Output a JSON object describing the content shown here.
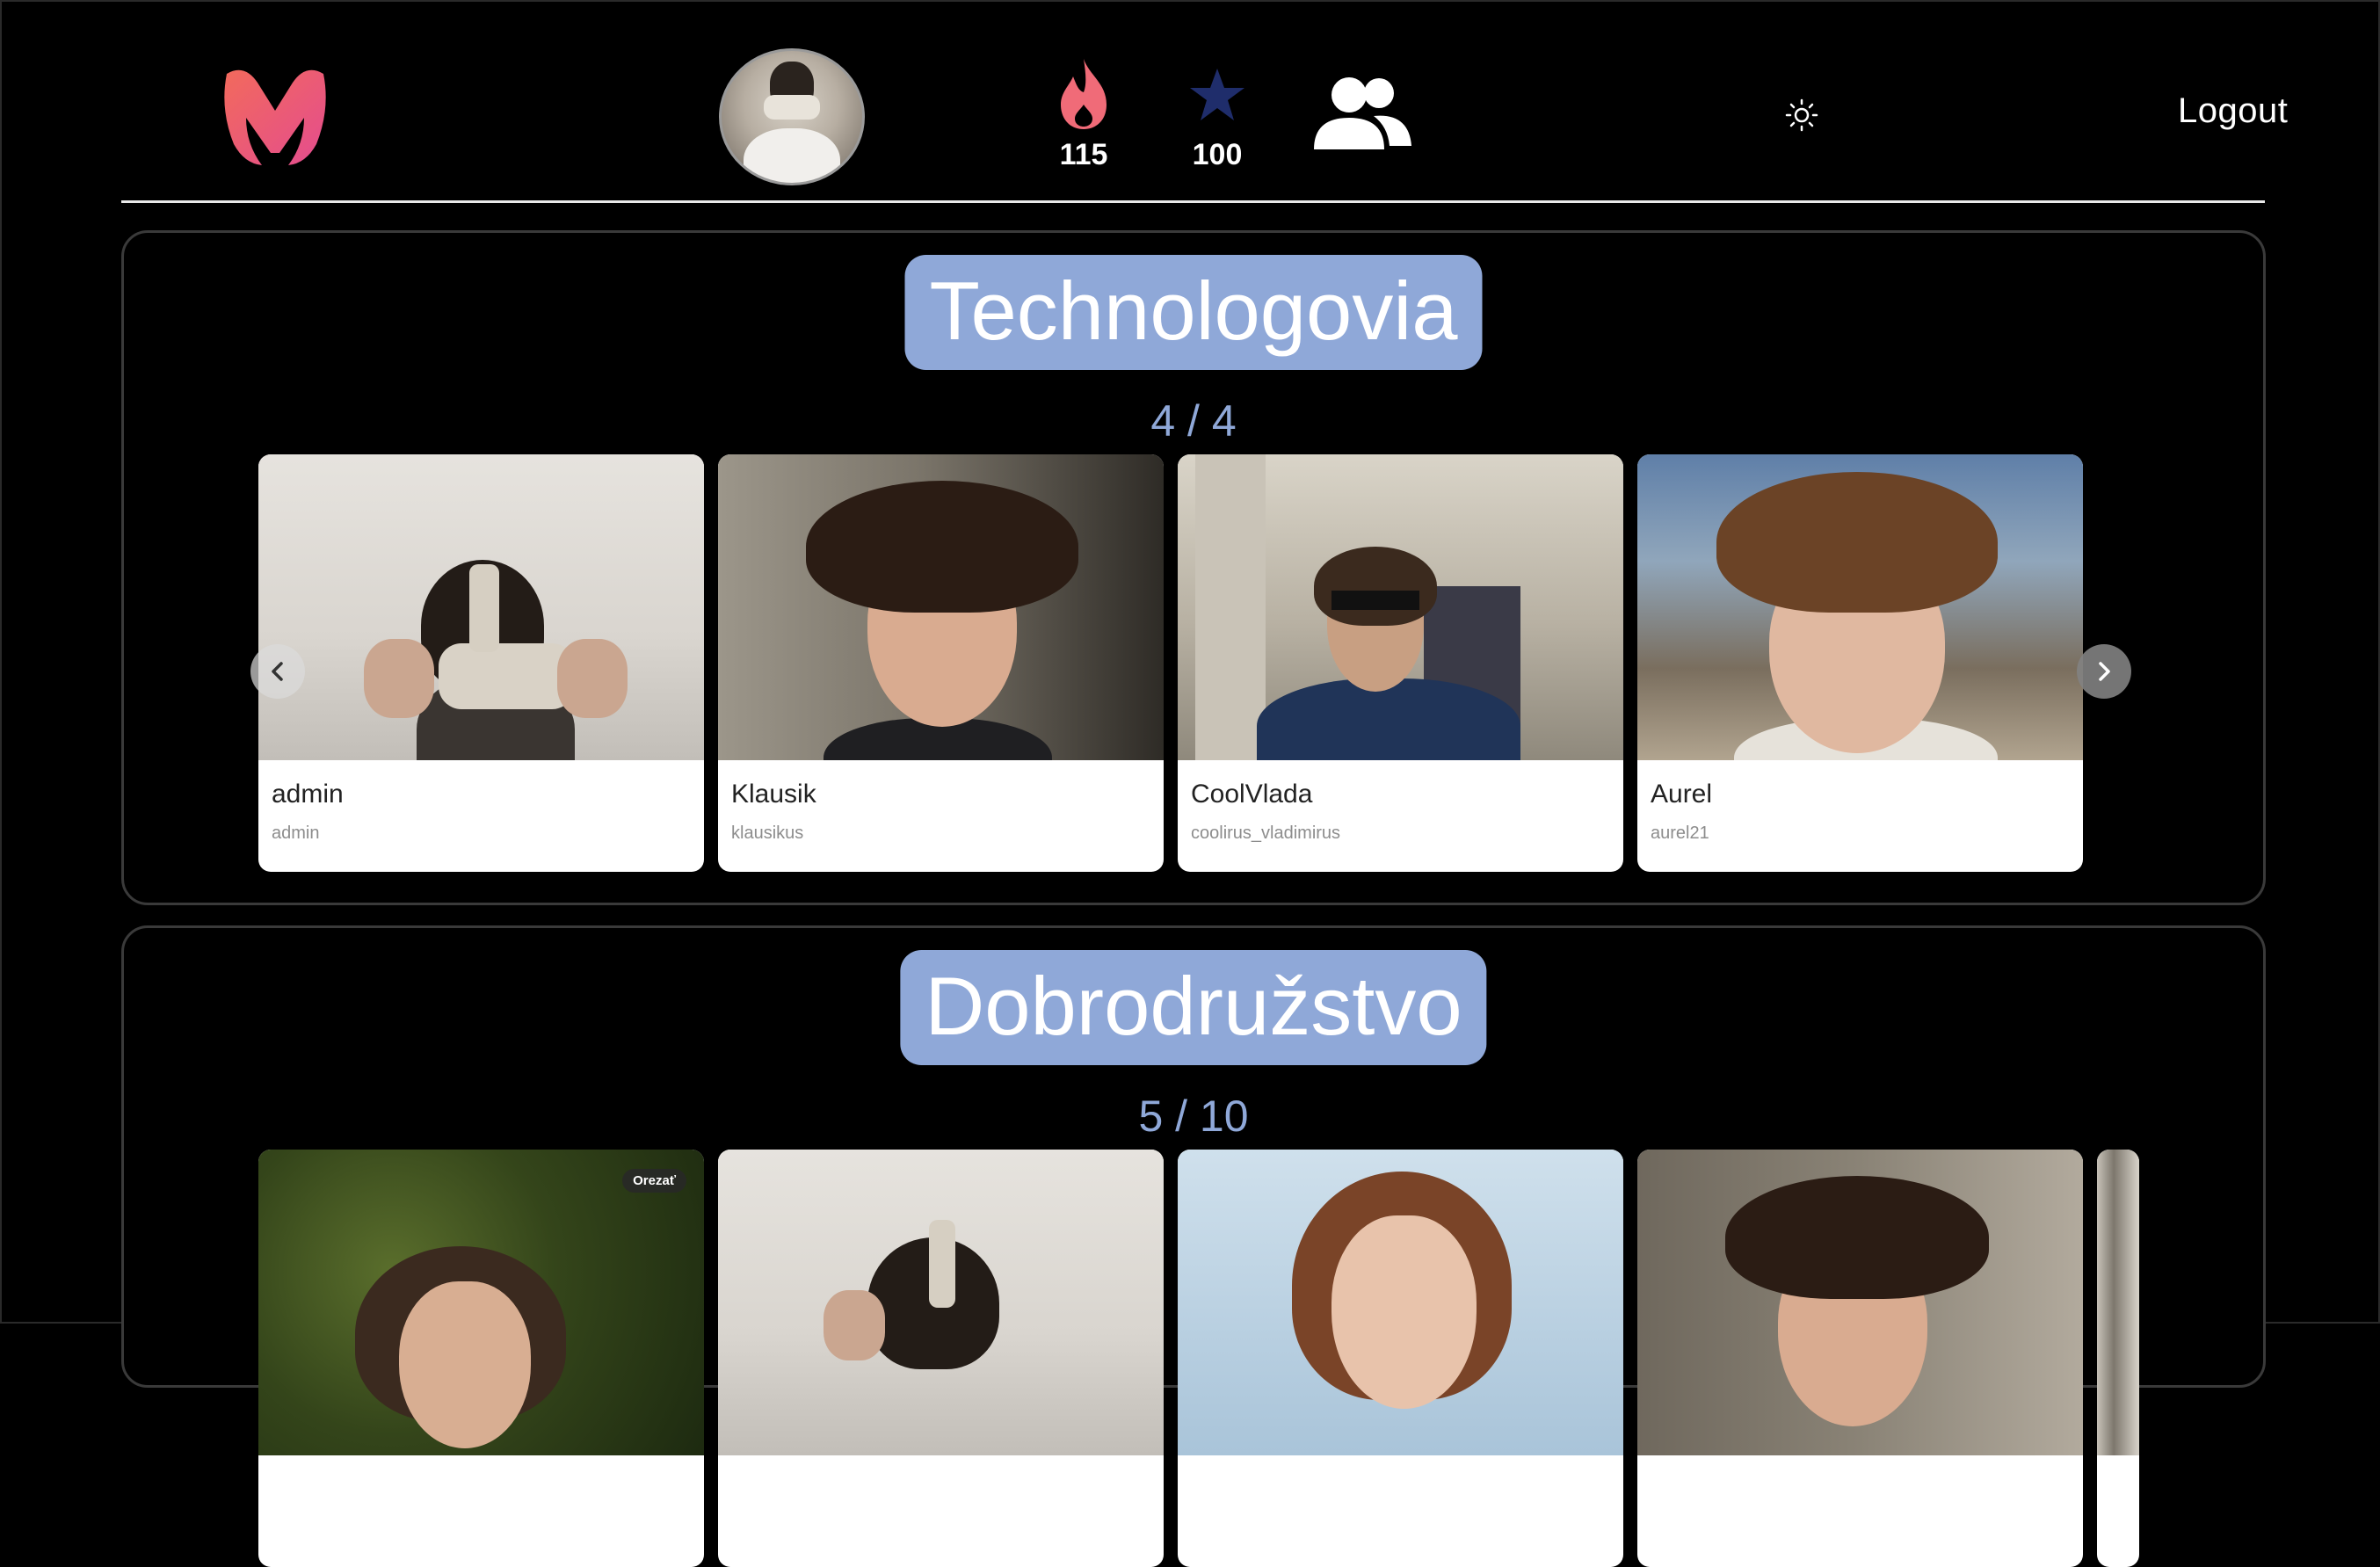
{
  "header": {
    "fire_count": "115",
    "star_count": "100",
    "logout_label": "Logout",
    "colors": {
      "logo_gradient_start": "#f05a6e",
      "logo_gradient_end": "#e8518e",
      "fire": "#f06b78",
      "star": "#1f2d6b"
    },
    "icons": [
      "logo-icon",
      "fire-icon",
      "star-icon",
      "friends-icon",
      "sun-icon"
    ]
  },
  "sections": [
    {
      "title": "Technologovia",
      "count": "4 / 4",
      "cards": [
        {
          "name": "admin",
          "username": "admin"
        },
        {
          "name": "Klausik",
          "username": "klausikus"
        },
        {
          "name": "CoolVlada",
          "username": "coolirus_vladimirus"
        },
        {
          "name": "Aurel",
          "username": "aurel21"
        }
      ]
    },
    {
      "title": "Dobrodružstvo",
      "count": "5 / 10",
      "badge": "Orezať"
    }
  ],
  "accent_color": "#8fa8d8"
}
